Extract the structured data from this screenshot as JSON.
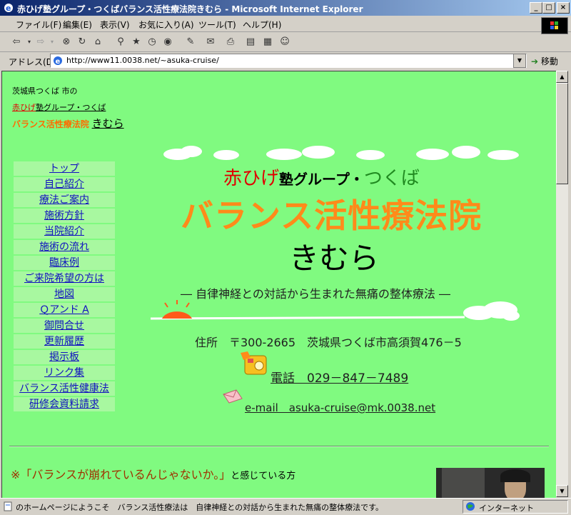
{
  "window": {
    "title": "赤ひげ塾グループ・つくばバランス活性療法院きむら - Microsoft Internet Explorer",
    "minimize": "_",
    "maximize": "□",
    "close": "×"
  },
  "menubar": {
    "items": [
      "ファイル(F)",
      "編集(E)",
      "表示(V)",
      "お気に入り(A)",
      "ツール(T)",
      "ヘルプ(H)"
    ]
  },
  "toolbar": {
    "icons": [
      "back-icon",
      "forward-icon",
      "stop-icon",
      "refresh-icon",
      "home-icon",
      "search-icon",
      "favorites-icon",
      "history-icon",
      "media-icon",
      "edit-icon",
      "mail-icon",
      "print-icon",
      "discuss-icon",
      "messenger-icon"
    ]
  },
  "address": {
    "label": "アドレス(D)",
    "url": "http://www11.0038.net/~asuka-cruise/",
    "go_label": "移動"
  },
  "page": {
    "intro_line1": "茨城県つくば 市の",
    "intro_red": "赤ひげ",
    "intro_line2_rest": "塾グループ・つくば",
    "intro_orange": "バランス活性療法院",
    "intro_kimura": "きむら",
    "heading_red": "赤ひげ",
    "heading_black": "塾グループ・",
    "heading_green": "つくば",
    "heading_main": "バランス活性療法院",
    "heading_kimura": "きむら",
    "tagline": "― 自律神経との対話から生まれた無痛の整体療法 ―",
    "address": "住所　〒300-2665　茨城県つくば市高須賀476－5",
    "tel": "電話　029－847－7489",
    "email": "e-mail　asuka-cruise@mk.0038.net",
    "quote_red": "※「バランスが崩れているんじゃないか。」",
    "quote_rest": "と感じている方",
    "nav": [
      "トップ",
      "自己紹介",
      "療法ご案内",
      "施術方針",
      "当院紹介",
      "施術の流れ",
      "臨床例",
      "ご来院希望の方は",
      "地図",
      "Ｑアンド A",
      "御問合せ",
      "更新履歴",
      "掲示板",
      "リンク集",
      "バランス活性健康法",
      "研修会資料請求"
    ]
  },
  "status": {
    "text": "のホームページにようこそ　バランス活性療法は　自律神経との対話から生まれた無痛の整体療法です。",
    "zone": "インターネット"
  },
  "colors": {
    "page_bg": "#80fa80",
    "nav_bg": "#a8f8a0",
    "link": "#1010c0",
    "red": "#e00000",
    "orange": "#ff8a1a",
    "green": "#208a20"
  }
}
